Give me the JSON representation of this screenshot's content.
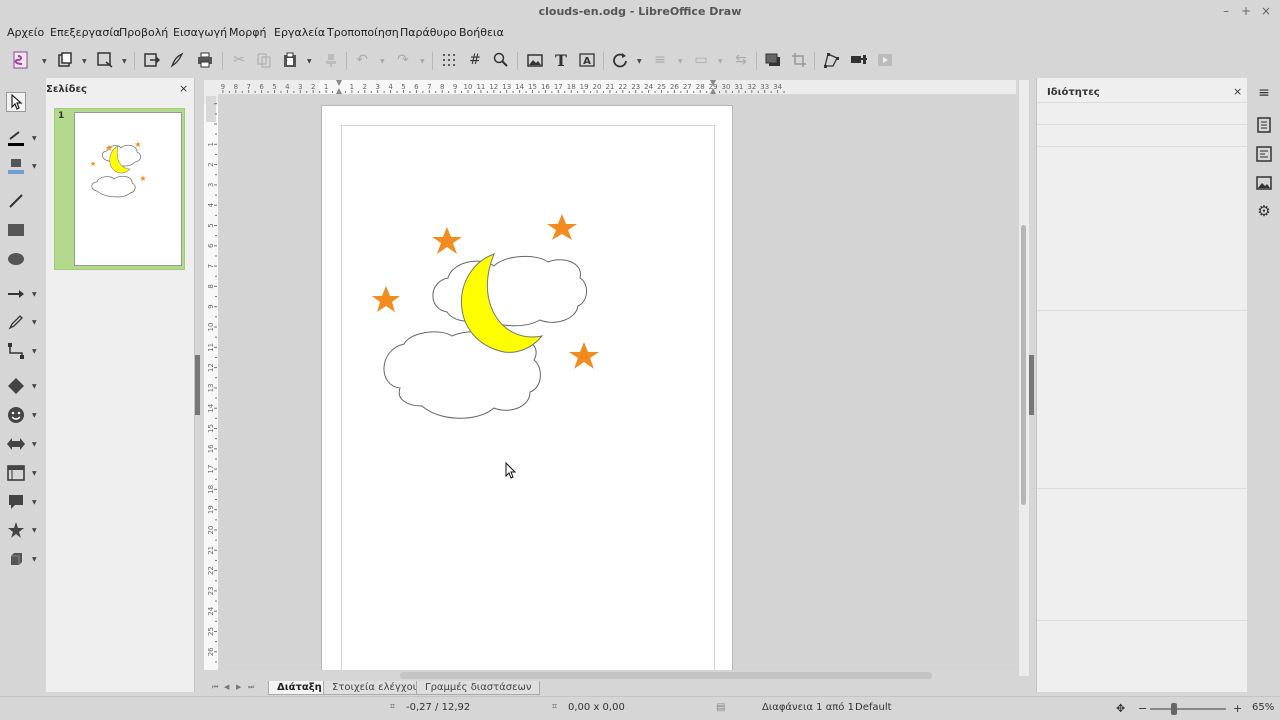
{
  "window": {
    "title": "clouds-en.odg - LibreOffice Draw",
    "minimize_glyph": "–",
    "maximize_glyph": "+",
    "close_glyph": "×"
  },
  "menubar": {
    "items": [
      "Αρχείο",
      "Επεξεργασία",
      "Προβολή",
      "Εισαγωγή",
      "Μορφή",
      "Εργαλεία",
      "Τροποποίηση",
      "Παράθυρο",
      "Βοήθεια"
    ]
  },
  "pages_panel": {
    "title": "Σελίδες",
    "close_glyph": "×",
    "pages": [
      {
        "number": "1"
      }
    ]
  },
  "tabs": {
    "nav_first": "⏮",
    "nav_prev": "◀",
    "nav_next": "▶",
    "nav_last": "⏭",
    "items": [
      "Διάταξη",
      "Στοιχεία ελέγχου",
      "Γραμμές διαστάσεων"
    ],
    "active_index": 0
  },
  "properties_panel": {
    "title": "Ιδιότητες",
    "close_glyph": "×"
  },
  "statusbar": {
    "position": "-0,27 / 12,92",
    "size": "0,00 x 0,00",
    "slide": "Διαφάνεια 1 από 1",
    "master": "Default",
    "zoom": "65%",
    "zoom_minus": "−",
    "zoom_plus": "+"
  },
  "drawing": {
    "star_color": "#f28c1e",
    "moon_color": "#ffff00",
    "cloud_stroke": "#666666"
  },
  "icons": {
    "menu": "≡"
  }
}
